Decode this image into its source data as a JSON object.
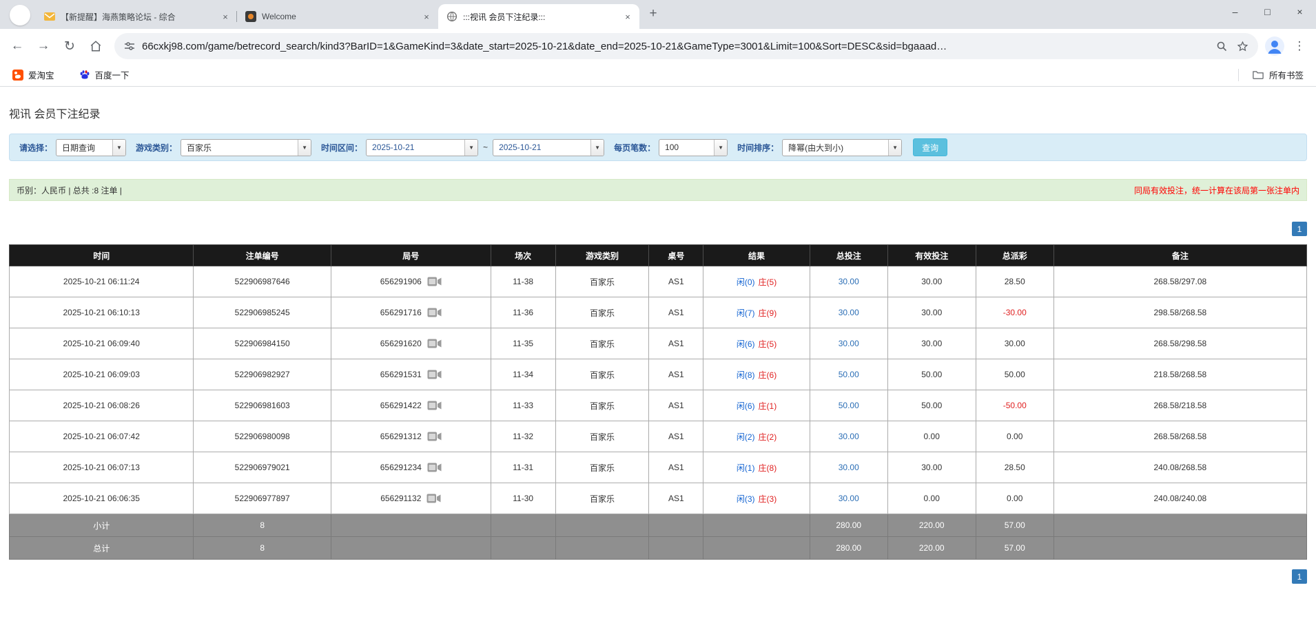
{
  "window": {
    "tabs": [
      {
        "title": "【新提醒】海燕策略论坛 - 综合",
        "state": "inactive"
      },
      {
        "title": "Welcome",
        "state": "inactive"
      },
      {
        "title": ":::视讯 会员下注纪录:::",
        "state": "active"
      }
    ],
    "controls": {
      "minimize": "–",
      "maximize": "□",
      "close": "×"
    },
    "new_tab": "+",
    "tab_close": "×"
  },
  "toolbar": {
    "back": "←",
    "forward": "→",
    "refresh": "↻",
    "menu": "⋮",
    "url": "66cxkj98.com/game/betrecord_search/kind3?BarID=1&GameKind=3&date_start=2025-10-21&date_end=2025-10-21&GameType=3001&Limit=100&Sort=DESC&sid=bgaaad…"
  },
  "bookmarks": {
    "items": [
      {
        "label": "爱淘宝"
      },
      {
        "label": "百度一下"
      }
    ],
    "all_label": "所有书签"
  },
  "page": {
    "title": "视讯 会员下注纪录",
    "filters": {
      "select_label": "请选择：",
      "select_value": "日期查询",
      "game_label": "游戏类别：",
      "game_value": "百家乐",
      "range_label": "时间区间：",
      "date_start": "2025-10-21",
      "separator": "~",
      "date_end": "2025-10-21",
      "page_size_label": "每页笔数：",
      "page_size_value": "100",
      "sort_label": "时间排序：",
      "sort_value": "降幂(由大到小)",
      "search_label": "查询",
      "arrow": "▼"
    },
    "info": {
      "left": "币别：人民币 | 总共 :8 注单 |",
      "right": "同局有效投注，统一计算在该局第一张注单内"
    },
    "pagination": "1",
    "colors": {
      "filter_bg": "#d9edf7",
      "info_bg": "#dff0d8",
      "header_bg": "#1a1a1a",
      "footer_bg": "#8f8f8f",
      "button_bg": "#5bc0de",
      "pagination_bg": "#337ab7",
      "player_blue": "#1464d2",
      "banker_red": "#e02020",
      "negative_red": "#e02020",
      "warning_red": "#ff0000",
      "link_blue": "#2a6db5"
    },
    "table": {
      "headers": [
        "时间",
        "注单编号",
        "局号",
        "场次",
        "游戏类别",
        "桌号",
        "结果",
        "总投注",
        "有效投注",
        "总派彩",
        "备注"
      ],
      "rows": [
        {
          "time": "2025-10-21 06:11:24",
          "bet_id": "522906987646",
          "round": "656291906",
          "session": "11-38",
          "game": "百家乐",
          "table": "AS1",
          "result_player": "闲(0)",
          "result_banker": "庄(5)",
          "total_bet": "30.00",
          "valid_bet": "30.00",
          "payout": "28.50",
          "note": "268.58/297.08"
        },
        {
          "time": "2025-10-21 06:10:13",
          "bet_id": "522906985245",
          "round": "656291716",
          "session": "11-36",
          "game": "百家乐",
          "table": "AS1",
          "result_player": "闲(7)",
          "result_banker": "庄(9)",
          "total_bet": "30.00",
          "valid_bet": "30.00",
          "payout": "-30.00",
          "note": "298.58/268.58"
        },
        {
          "time": "2025-10-21 06:09:40",
          "bet_id": "522906984150",
          "round": "656291620",
          "session": "11-35",
          "game": "百家乐",
          "table": "AS1",
          "result_player": "闲(6)",
          "result_banker": "庄(5)",
          "total_bet": "30.00",
          "valid_bet": "30.00",
          "payout": "30.00",
          "note": "268.58/298.58"
        },
        {
          "time": "2025-10-21 06:09:03",
          "bet_id": "522906982927",
          "round": "656291531",
          "session": "11-34",
          "game": "百家乐",
          "table": "AS1",
          "result_player": "闲(8)",
          "result_banker": "庄(6)",
          "total_bet": "50.00",
          "valid_bet": "50.00",
          "payout": "50.00",
          "note": "218.58/268.58"
        },
        {
          "time": "2025-10-21 06:08:26",
          "bet_id": "522906981603",
          "round": "656291422",
          "session": "11-33",
          "game": "百家乐",
          "table": "AS1",
          "result_player": "闲(6)",
          "result_banker": "庄(1)",
          "total_bet": "50.00",
          "valid_bet": "50.00",
          "payout": "-50.00",
          "note": "268.58/218.58"
        },
        {
          "time": "2025-10-21 06:07:42",
          "bet_id": "522906980098",
          "round": "656291312",
          "session": "11-32",
          "game": "百家乐",
          "table": "AS1",
          "result_player": "闲(2)",
          "result_banker": "庄(2)",
          "total_bet": "30.00",
          "valid_bet": "0.00",
          "payout": "0.00",
          "note": "268.58/268.58"
        },
        {
          "time": "2025-10-21 06:07:13",
          "bet_id": "522906979021",
          "round": "656291234",
          "session": "11-31",
          "game": "百家乐",
          "table": "AS1",
          "result_player": "闲(1)",
          "result_banker": "庄(8)",
          "total_bet": "30.00",
          "valid_bet": "30.00",
          "payout": "28.50",
          "note": "240.08/268.58"
        },
        {
          "time": "2025-10-21 06:06:35",
          "bet_id": "522906977897",
          "round": "656291132",
          "session": "11-30",
          "game": "百家乐",
          "table": "AS1",
          "result_player": "闲(3)",
          "result_banker": "庄(3)",
          "total_bet": "30.00",
          "valid_bet": "0.00",
          "payout": "0.00",
          "note": "240.08/240.08"
        }
      ],
      "footer_rows": [
        {
          "label": "小计",
          "count": "8",
          "total_bet": "280.00",
          "valid_bet": "220.00",
          "payout": "57.00"
        },
        {
          "label": "总计",
          "count": "8",
          "total_bet": "280.00",
          "valid_bet": "220.00",
          "payout": "57.00"
        }
      ]
    }
  }
}
